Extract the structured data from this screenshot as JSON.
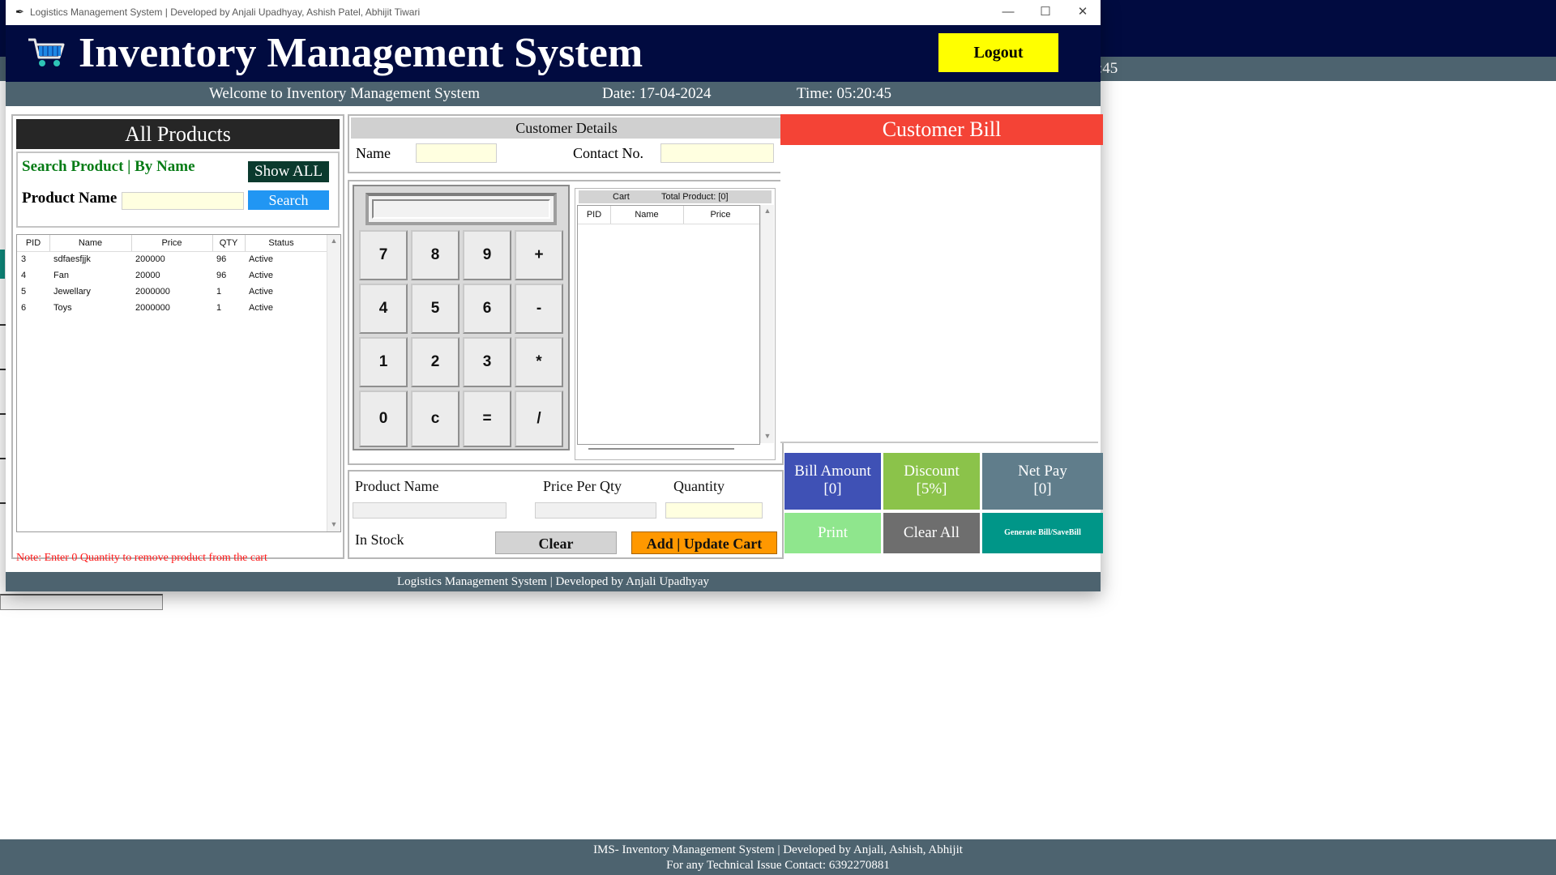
{
  "background_window": {
    "time_fragment": ":45",
    "footer_line1": "IMS- Inventory Management System | Developed by Anjali, Ashish,  Abhijit",
    "footer_line2": "For any Technical Issue Contact: 6392270881"
  },
  "window": {
    "title": "Logistics Management System | Developed by Anjali Upadhyay, Ashish Patel, Abhijit Tiwari",
    "controls": {
      "minimize": "—",
      "maximize": "☐",
      "close": "✕"
    }
  },
  "header": {
    "title": "Inventory Management System",
    "logout_label": "Logout",
    "icon": "cart-icon"
  },
  "subbar": {
    "welcome": "Welcome to Inventory Management System",
    "date": "Date: 17-04-2024",
    "time": "Time: 05:20:45"
  },
  "products": {
    "title": "All Products",
    "search_label": "Search Product | By Name",
    "show_all_label": "Show ALL",
    "product_name_label": "Product Name",
    "product_name_value": "",
    "search_label_btn": "Search",
    "columns": [
      "PID",
      "Name",
      "Price",
      "QTY",
      "Status"
    ],
    "rows": [
      [
        "3",
        "sdfaesfjjk",
        "200000",
        "96",
        "Active"
      ],
      [
        "4",
        "Fan",
        "20000",
        "96",
        "Active"
      ],
      [
        "5",
        "Jewellary",
        "2000000",
        "1",
        "Active"
      ],
      [
        "6",
        "Toys",
        "2000000",
        "1",
        "Active"
      ]
    ],
    "note": "Note: Enter 0 Quantity to remove product from the cart"
  },
  "customer": {
    "title": "Customer Details",
    "name_label": "Name",
    "name_value": "",
    "contact_label": "Contact No.",
    "contact_value": ""
  },
  "calculator": {
    "display": "",
    "keys": [
      [
        "7",
        "8",
        "9",
        "+"
      ],
      [
        "4",
        "5",
        "6",
        "-"
      ],
      [
        "1",
        "2",
        "3",
        "*"
      ],
      [
        "0",
        "c",
        "=",
        "/"
      ]
    ]
  },
  "cart": {
    "title": "Cart",
    "total_label": "Total Product: [0]",
    "columns": [
      "PID",
      "Name",
      "Price"
    ]
  },
  "entry": {
    "product_name_label": "Product Name",
    "price_label": "Price Per Qty",
    "quantity_label": "Quantity",
    "in_stock_label": "In Stock",
    "clear_label": "Clear",
    "add_label": "Add | Update Cart"
  },
  "bill": {
    "title": "Customer Bill",
    "bill_amount_label": "Bill Amount",
    "bill_amount_value": "[0]",
    "discount_label": "Discount",
    "discount_value": "[5%]",
    "net_pay_label": "Net Pay",
    "net_pay_value": "[0]",
    "print_label": "Print",
    "clear_all_label": "Clear All",
    "generate_label": "Generate Bill/SaveBill"
  },
  "footer": {
    "text": "Logistics Management System | Developed by Anjali Upadhyay"
  },
  "colors": {
    "navy": "#010b40",
    "slate": "#4d636f",
    "yellow": "#ffff00",
    "red": "#f44336",
    "blue": "#3f51b5",
    "green": "#8bc34a",
    "teal": "#009688",
    "orange": "#ff9800"
  }
}
